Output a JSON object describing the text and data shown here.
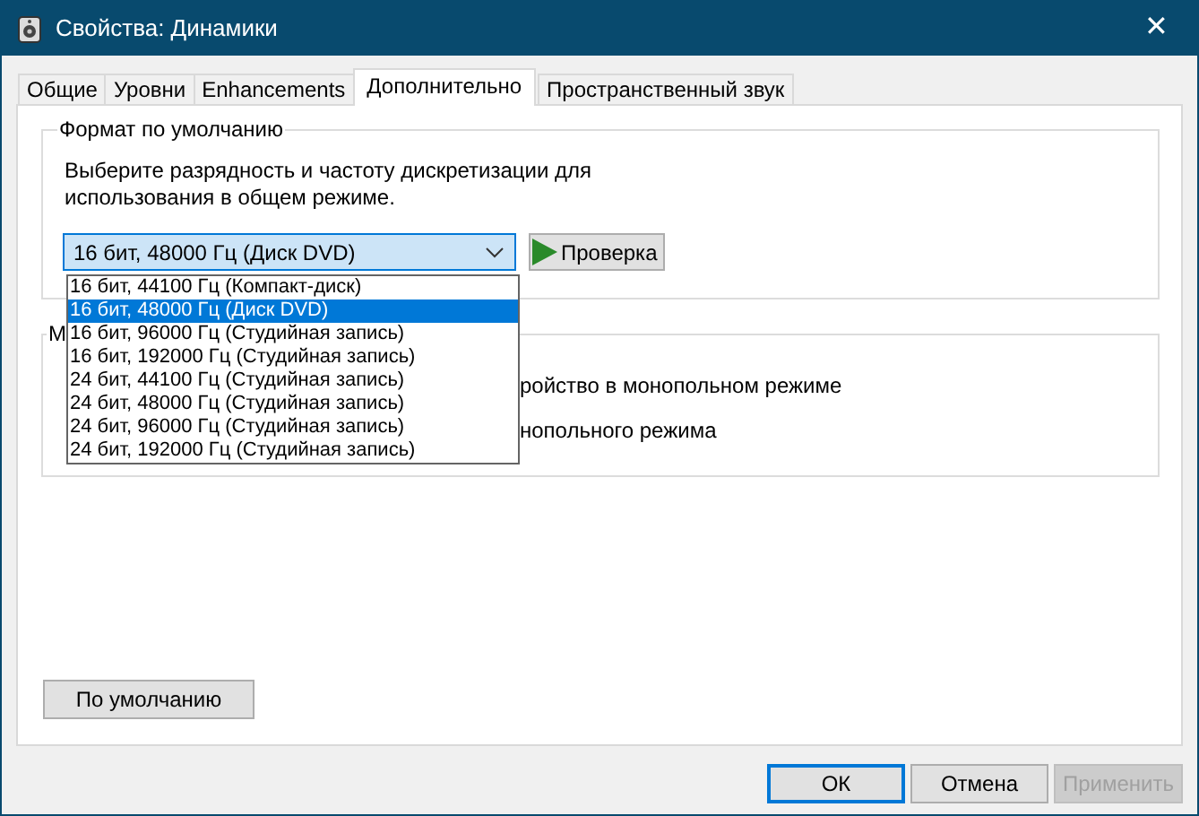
{
  "window": {
    "title": "Свойства: Динамики",
    "close": "✕"
  },
  "tabs": [
    {
      "label": "Общие",
      "selected": false
    },
    {
      "label": "Уровни",
      "selected": false
    },
    {
      "label": "Enhancements",
      "selected": false
    },
    {
      "label": "Дополнительно",
      "selected": true
    },
    {
      "label": "Пространственный звук",
      "selected": false
    }
  ],
  "default_format": {
    "legend": "Формат по умолчанию",
    "description": "Выберите разрядность и частоту дискретизации для использования в общем режиме.",
    "combo_value": "16 бит, 48000 Гц (Диск DVD)",
    "test_button": "Проверка",
    "options": [
      {
        "label": "16 бит, 44100 Гц (Компакт-диск)",
        "selected": false
      },
      {
        "label": "16 бит, 48000 Гц (Диск DVD)",
        "selected": true
      },
      {
        "label": "16 бит, 96000 Гц (Студийная запись)",
        "selected": false
      },
      {
        "label": "16 бит, 192000 Гц (Студийная запись)",
        "selected": false
      },
      {
        "label": "24 бит, 44100 Гц (Студийная запись)",
        "selected": false
      },
      {
        "label": "24 бит, 48000 Гц (Студийная запись)",
        "selected": false
      },
      {
        "label": "24 бит, 96000 Гц (Студийная запись)",
        "selected": false
      },
      {
        "label": "24 бит, 192000 Гц (Студийная запись)",
        "selected": false
      }
    ]
  },
  "exclusive_mode": {
    "legend": "М",
    "lines": [
      "ройство в монопольном режиме",
      "нопольного режима"
    ]
  },
  "restore_button": "По умолчанию",
  "buttons": [
    {
      "label": "ОК",
      "default": true,
      "disabled": false
    },
    {
      "label": "Отмена",
      "default": false,
      "disabled": false
    },
    {
      "label": "Применить",
      "default": false,
      "disabled": true
    }
  ]
}
